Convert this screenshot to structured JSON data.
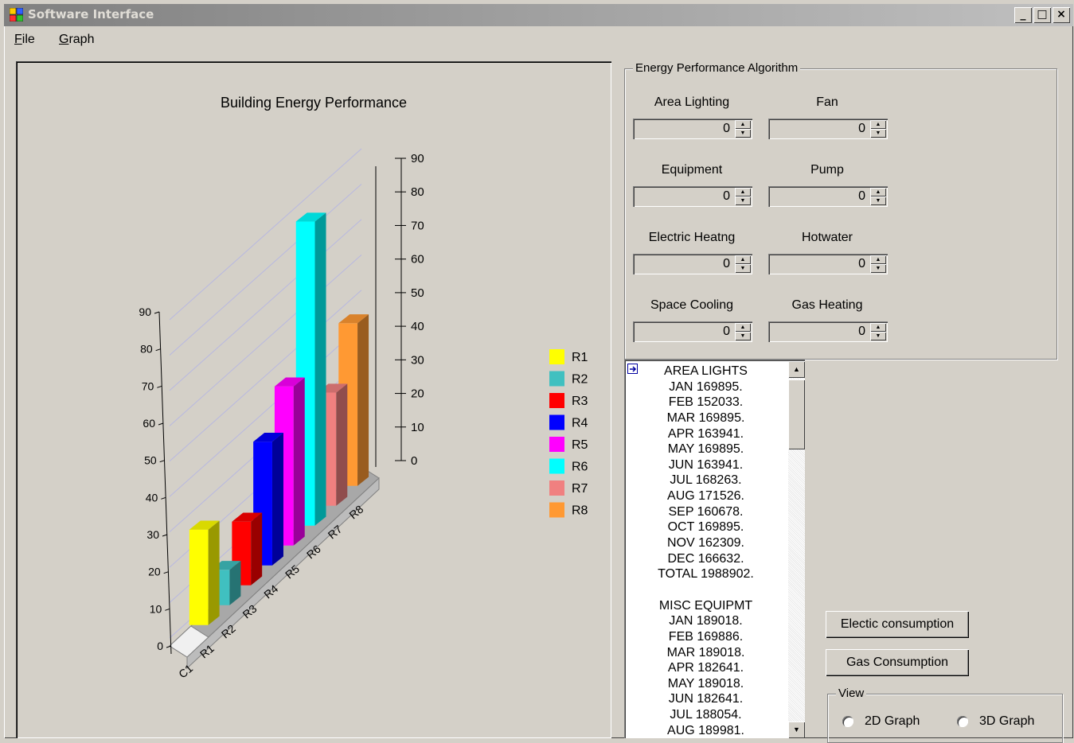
{
  "window": {
    "title": "Software Interface",
    "minimize_label": "_",
    "maximize_label": "□",
    "close_label": "×"
  },
  "menu": {
    "file": {
      "hotkey": "F",
      "rest": "ile"
    },
    "graph": {
      "hotkey": "G",
      "rest": "raph"
    }
  },
  "chart_data": {
    "type": "bar",
    "title": "Building Energy Performance",
    "categories": [
      "C1"
    ],
    "series": [
      {
        "name": "R1",
        "color": "#ffff00",
        "values": [
          27
        ]
      },
      {
        "name": "R2",
        "color": "#40c0c0",
        "values": [
          10
        ]
      },
      {
        "name": "R3",
        "color": "#ff0000",
        "values": [
          18
        ]
      },
      {
        "name": "R4",
        "color": "#0000ff",
        "values": [
          35
        ]
      },
      {
        "name": "R5",
        "color": "#ff00ff",
        "values": [
          45
        ]
      },
      {
        "name": "R6",
        "color": "#00ffff",
        "values": [
          86
        ]
      },
      {
        "name": "R7",
        "color": "#f08080",
        "values": [
          32
        ]
      },
      {
        "name": "R8",
        "color": "#ff9933",
        "values": [
          46
        ]
      }
    ],
    "depth_labels": [
      "C1",
      "R1",
      "R2",
      "R3",
      "R4",
      "R5",
      "R6",
      "R7",
      "R8"
    ],
    "ylim": [
      0,
      90
    ],
    "y_ticks": [
      "0",
      "10",
      "20",
      "30",
      "40",
      "50",
      "60",
      "70",
      "80",
      "90"
    ],
    "legend_position": "right",
    "grid": true,
    "projection": "3d"
  },
  "algorithm": {
    "legend": "Energy Performance Algorithm",
    "fields": [
      {
        "label": "Area Lighting",
        "value": "0"
      },
      {
        "label": "Fan",
        "value": "0"
      },
      {
        "label": "Equipment",
        "value": "0"
      },
      {
        "label": "Pump",
        "value": "0"
      },
      {
        "label": "Electric Heatng",
        "value": "0"
      },
      {
        "label": "Hotwater",
        "value": "0"
      },
      {
        "label": "Space Cooling",
        "value": "0"
      },
      {
        "label": "Gas Heating",
        "value": "0"
      }
    ]
  },
  "report": {
    "lines": [
      "AREA LIGHTS",
      "JAN 169895.",
      "FEB 152033.",
      "MAR 169895.",
      "APR 163941.",
      "MAY 169895.",
      "JUN 163941.",
      "JUL 168263.",
      "AUG 171526.",
      "SEP 160678.",
      "OCT 169895.",
      "NOV 162309.",
      "DEC 166632.",
      "TOTAL 1988902.",
      "",
      "MISC EQUIPMT",
      "JAN 189018.",
      "FEB 169886.",
      "MAR 189018.",
      "APR 182641.",
      "MAY 189018.",
      "JUN 182641.",
      "JUL 188054.",
      "AUG 189981."
    ]
  },
  "buttons": {
    "electric": "Electic consumption",
    "gas": "Gas Consumption"
  },
  "view": {
    "legend": "View",
    "option_2d": "2D Graph",
    "option_3d": "3D Graph"
  }
}
